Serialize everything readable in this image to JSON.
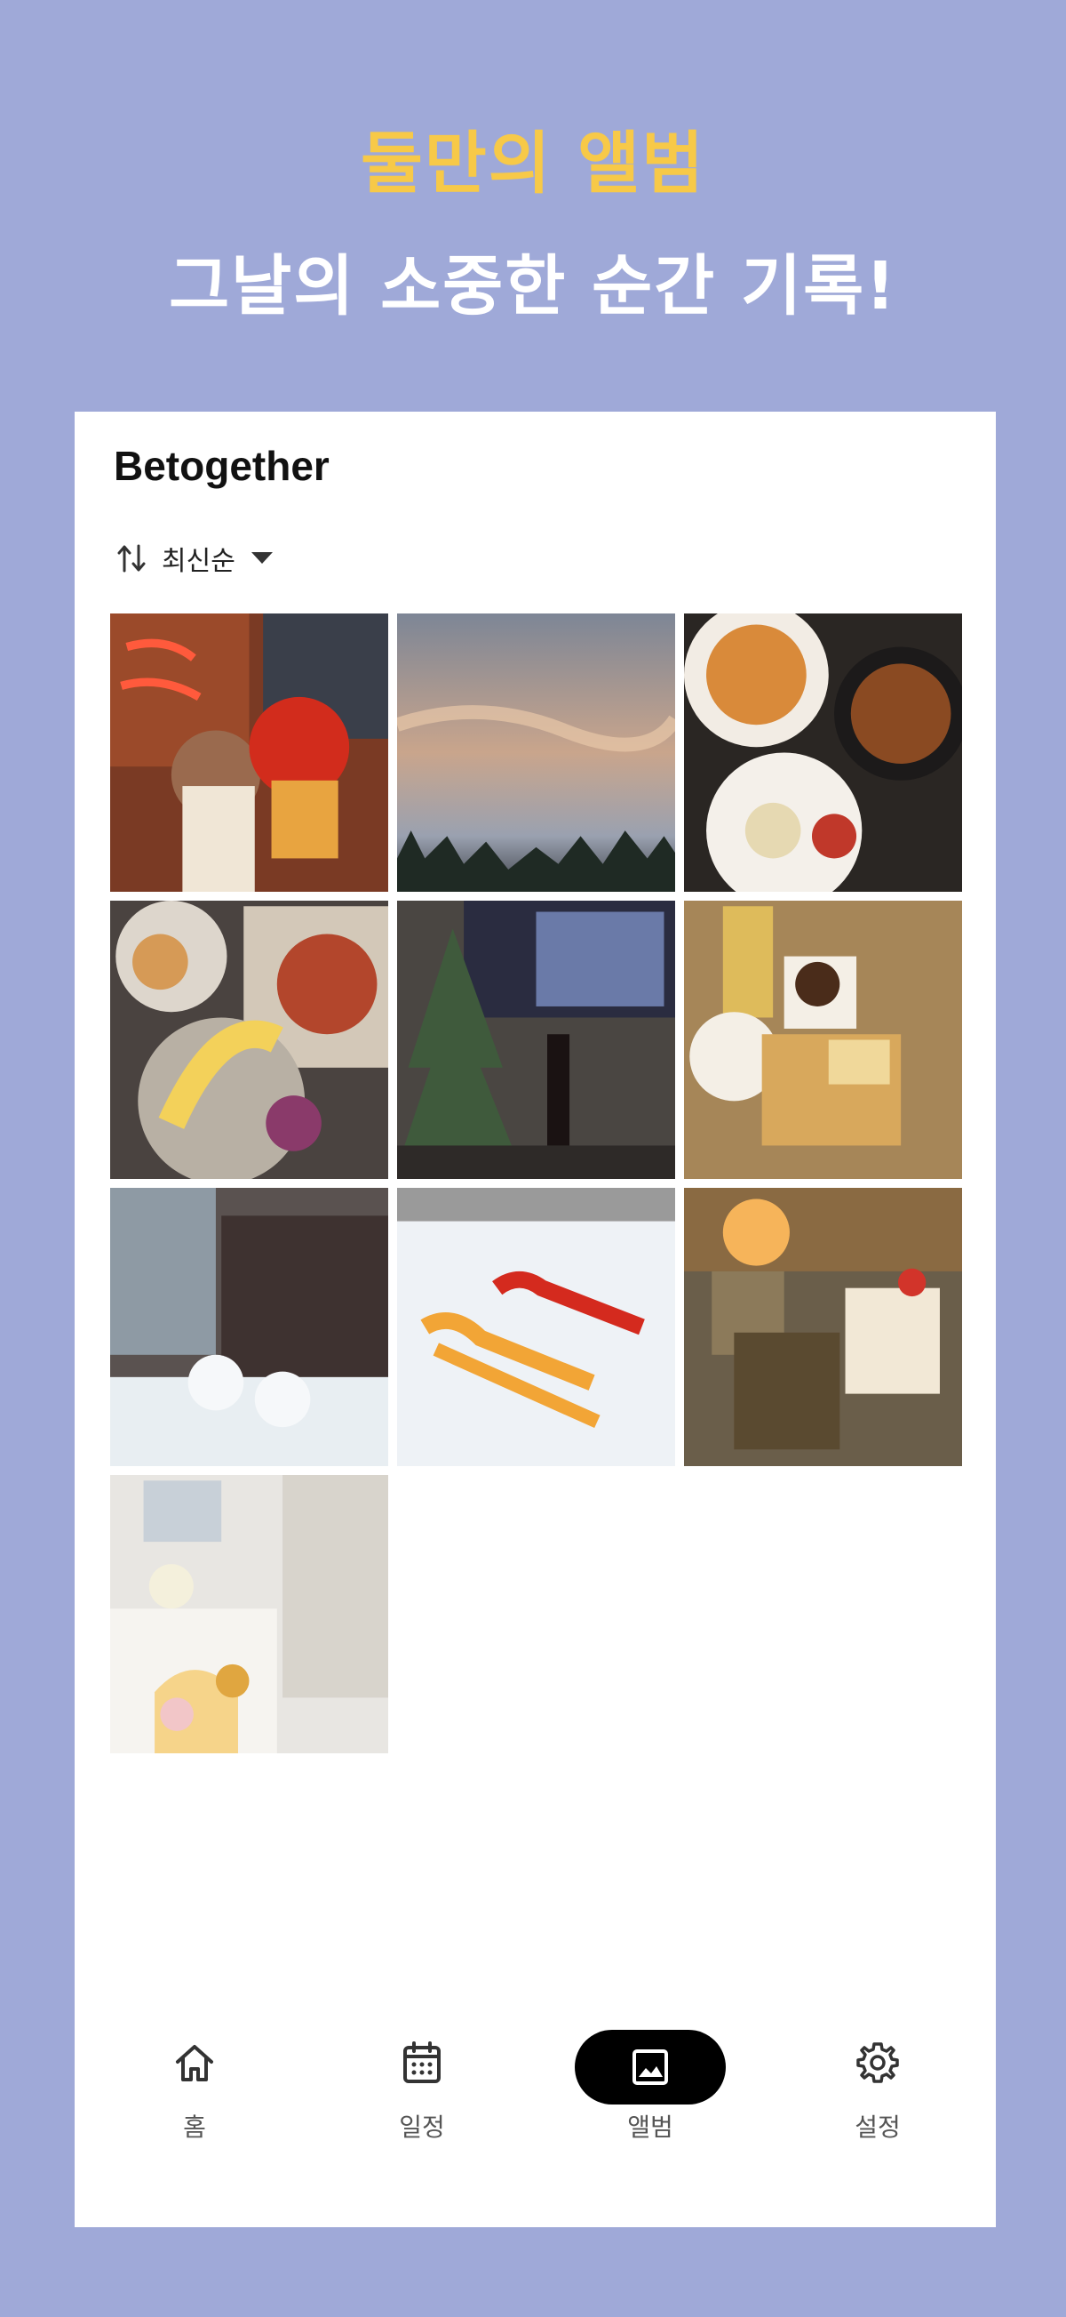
{
  "promo": {
    "headline": "둘만의 앨범",
    "subheadline": "그날의 소중한 순간 기록!",
    "headline_color": "#f7c948",
    "subheadline_color": "#ffffff",
    "background_color": "#9fa9d8"
  },
  "app": {
    "title": "Betogether"
  },
  "sort": {
    "icon": "sort-arrows-icon",
    "label": "최신순",
    "caret": "caret-down-icon"
  },
  "photos": [
    {
      "subject": "ice cream shop with neon sign and figurine"
    },
    {
      "subject": "sunset sky over pine trees"
    },
    {
      "subject": "plates of food on table"
    },
    {
      "subject": "brunch plates with banana and fruit"
    },
    {
      "subject": "christmas tree, wine bottle and tv"
    },
    {
      "subject": "coffee and french toast on tray"
    },
    {
      "subject": "snow ducks on balcony"
    },
    {
      "subject": "snowball makers on snow"
    },
    {
      "subject": "cafe desserts with lamp"
    },
    {
      "subject": "room corner with clock and lamp"
    }
  ],
  "nav": {
    "items": [
      {
        "label": "홈",
        "icon": "home-icon",
        "active": false
      },
      {
        "label": "일정",
        "icon": "calendar-icon",
        "active": false
      },
      {
        "label": "앨범",
        "icon": "image-icon",
        "active": true
      },
      {
        "label": "설정",
        "icon": "gear-icon",
        "active": false
      }
    ]
  }
}
